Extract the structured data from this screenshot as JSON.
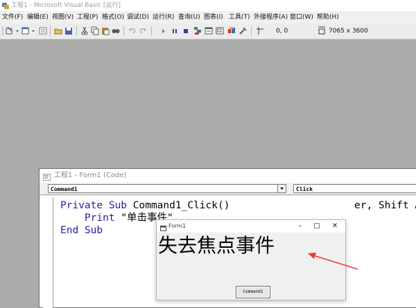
{
  "window": {
    "title": "工程1 - Microsoft Visual Basic [运行]"
  },
  "menu": [
    "文件(F)",
    "编辑(E)",
    "视图(V)",
    "工程(P)",
    "格式(O)",
    "调试(D)",
    "运行(R)",
    "查询(U)",
    "图表(I)",
    "工具(T)",
    "外接程序(A)",
    "窗口(W)",
    "帮助(H)"
  ],
  "toolbar": {
    "position": "0, 0",
    "size": "7065 x 3600",
    "icons": [
      "add-project-icon",
      "add-form-icon",
      "menu-editor-icon",
      "open-icon",
      "save-icon",
      "cut-icon",
      "copy-icon",
      "paste-icon",
      "find-icon",
      "undo-icon",
      "redo-icon",
      "start-icon",
      "break-icon",
      "end-icon",
      "project-explorer-icon",
      "properties-icon",
      "form-layout-icon",
      "object-browser-icon",
      "toolbox-icon",
      "position-icon",
      "size-icon"
    ]
  },
  "code_window": {
    "title": "工程1 - Form1 (Code)",
    "object_combo": "Command1",
    "procedure_combo": "Click",
    "lines": {
      "l1_kw": "Private Sub ",
      "l1_rest": "Command1_Click()",
      "l1_tail": "er, Shift A",
      "l2_indent": "    ",
      "l2_print": "Print ",
      "l2_str": "\"单击事件\"",
      "l3_kw": "End Sub"
    }
  },
  "form1": {
    "title": "Form1",
    "printed_text": "失去焦点事件",
    "button_label": "Command1"
  },
  "colors": {
    "workspace": "#ababab",
    "keyword": "#1f1fa8",
    "arrow": "#e53935"
  }
}
